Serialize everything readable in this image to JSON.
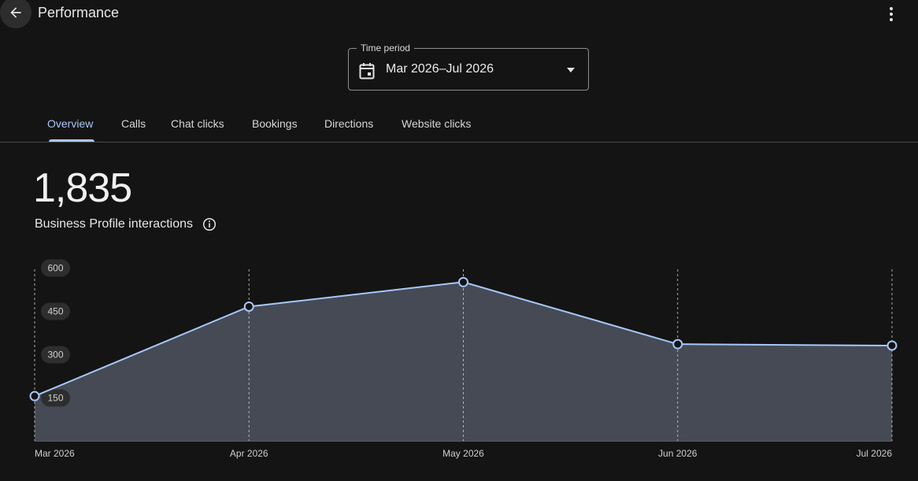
{
  "header": {
    "title": "Performance",
    "back_icon": "arrow-back-icon",
    "more_icon": "more-vert-icon"
  },
  "period": {
    "label": "Time period",
    "value": "Mar 2026–Jul 2026",
    "icon": "calendar-icon",
    "caret_icon": "caret-down-icon"
  },
  "tabs": [
    {
      "label": "Overview",
      "active": true
    },
    {
      "label": "Calls",
      "active": false
    },
    {
      "label": "Chat clicks",
      "active": false
    },
    {
      "label": "Bookings",
      "active": false
    },
    {
      "label": "Directions",
      "active": false
    },
    {
      "label": "Website clicks",
      "active": false
    }
  ],
  "metric": {
    "value": "1,835",
    "label": "Business Profile interactions",
    "info_icon": "info-icon"
  },
  "colors": {
    "accent": "#a8c7fa",
    "area_fill": "#454a55",
    "background": "#141414"
  },
  "chart_data": {
    "type": "area",
    "categories": [
      "Mar 2026",
      "Apr 2026",
      "May 2026",
      "Jun 2026",
      "Jul 2026"
    ],
    "values": [
      155,
      465,
      550,
      335,
      330
    ],
    "yticks": [
      150,
      300,
      450,
      600
    ],
    "ylim": [
      0,
      600
    ],
    "grid": "vertical-dashed"
  }
}
